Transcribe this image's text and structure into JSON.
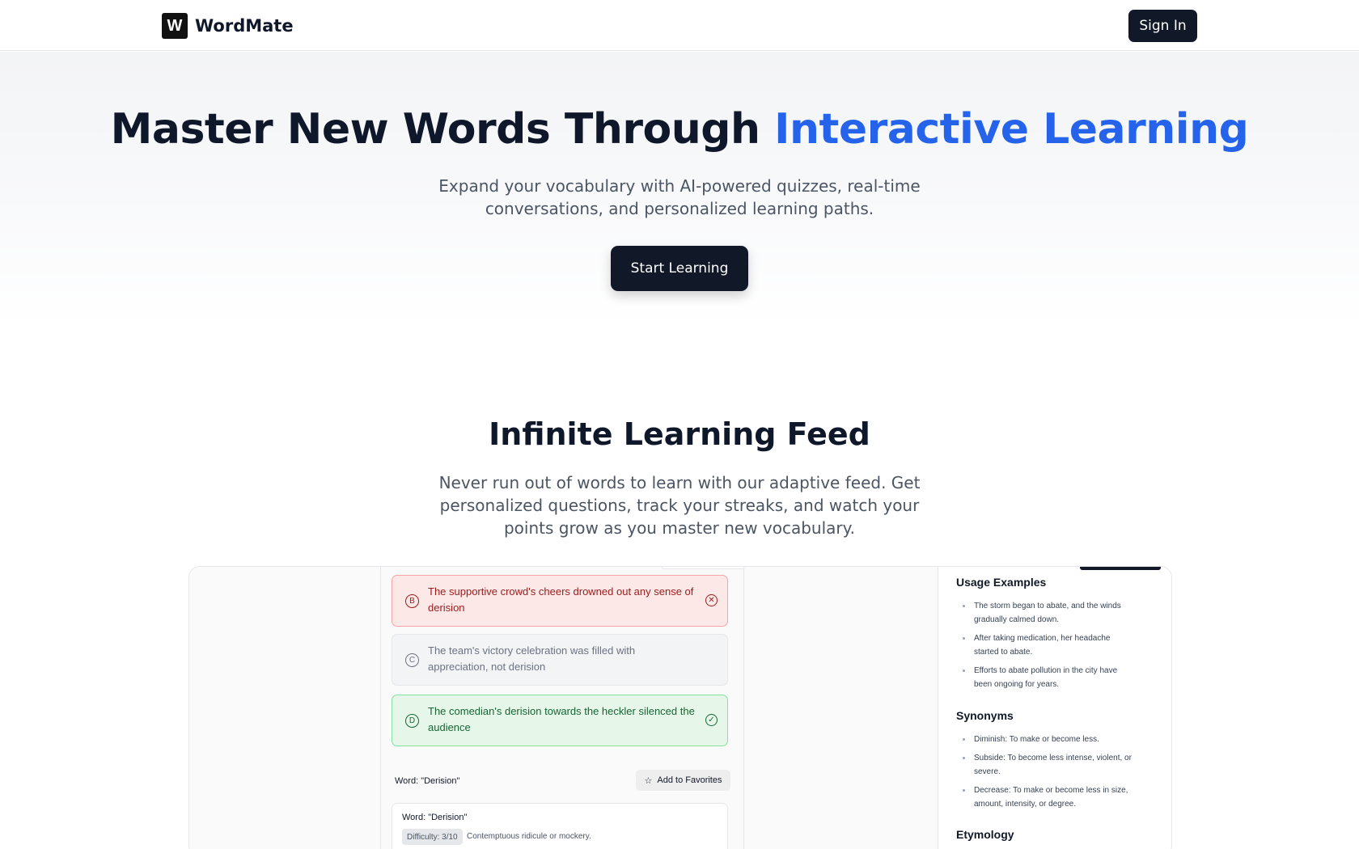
{
  "header": {
    "logo_mark": "W",
    "brand": "WordMate",
    "signin_label": "Sign In"
  },
  "hero": {
    "title_main": "Master New Words Through ",
    "title_accent": "Interactive Learning",
    "subtitle": "Expand your vocabulary with AI-powered quizzes, real-time conversations, and personalized learning paths.",
    "cta_label": "Start Learning"
  },
  "feed": {
    "title": "Infinite Learning Feed",
    "subtitle": "Never run out of words to learn with our adaptive feed. Get personalized questions, track your streaks, and watch your points grow as you master new vocabulary."
  },
  "quiz": {
    "options": [
      {
        "letter": "B",
        "text": "The supportive crowd's cheers drowned out any sense of derision",
        "state": "incorrect",
        "state_icon": "x-circle-icon"
      },
      {
        "letter": "C",
        "text": "The team's victory celebration was filled with appreciation, not derision",
        "state": "neutral"
      },
      {
        "letter": "D",
        "text": "The comedian's derision towards the heckler silenced the audience",
        "state": "correct",
        "state_icon": "check-circle-icon"
      }
    ],
    "word_label": "Word: \"Derision\"",
    "favorite_label": "Add to Favorites",
    "card": {
      "title": "Word: \"Derision\"",
      "difficulty": "Difficulty: 3/10",
      "definition": "Contemptuous ridicule or mockery."
    }
  },
  "details": {
    "usage_heading": "Usage Examples",
    "usage": [
      "The storm began to abate, and the winds gradually calmed down.",
      "After taking medication, her headache started to abate.",
      "Efforts to abate pollution in the city have been ongoing for years."
    ],
    "synonyms_heading": "Synonyms",
    "synonyms": [
      "Diminish: To make or become less.",
      "Subside: To become less intense, violent, or severe.",
      "Decrease: To make or become less in size, amount, intensity, or degree."
    ],
    "etymology_heading": "Etymology"
  },
  "colors": {
    "accent": "#2563eb",
    "dark": "#111827",
    "incorrect_bg": "#fde8e8",
    "correct_bg": "#e6f7ea"
  }
}
